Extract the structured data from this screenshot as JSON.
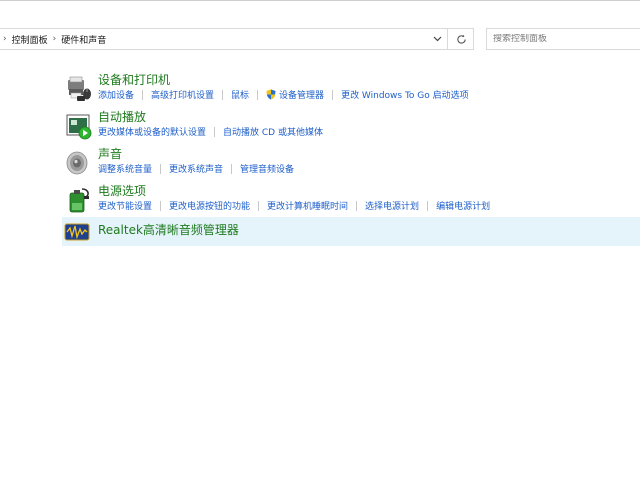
{
  "address_bar": {
    "breadcrumb": [
      "控制面板",
      "硬件和声音"
    ]
  },
  "search": {
    "placeholder": "搜索控制面板"
  },
  "categories": [
    {
      "title": "设备和打印机",
      "icon": "devices-printers-icon",
      "links": [
        "添加设备",
        "高级打印机设置",
        "鼠标",
        "设备管理器",
        "更改 Windows To Go 启动选项"
      ]
    },
    {
      "title": "自动播放",
      "icon": "autoplay-icon",
      "links": [
        "更改媒体或设备的默认设置",
        "自动播放 CD 或其他媒体"
      ]
    },
    {
      "title": "声音",
      "icon": "speaker-icon",
      "links": [
        "调整系统音量",
        "更改系统声音",
        "管理音频设备"
      ]
    },
    {
      "title": "电源选项",
      "icon": "power-options-icon",
      "links": [
        "更改节能设置",
        "更改电源按钮的功能",
        "更改计算机睡眠时间",
        "选择电源计划",
        "编辑电源计划"
      ]
    },
    {
      "title": "Realtek高清晰音频管理器",
      "icon": "realtek-audio-icon",
      "links": []
    }
  ],
  "colors": {
    "title": "#1e7a1e",
    "link": "#1e5fc9",
    "highlight": "#e5f3fb"
  }
}
